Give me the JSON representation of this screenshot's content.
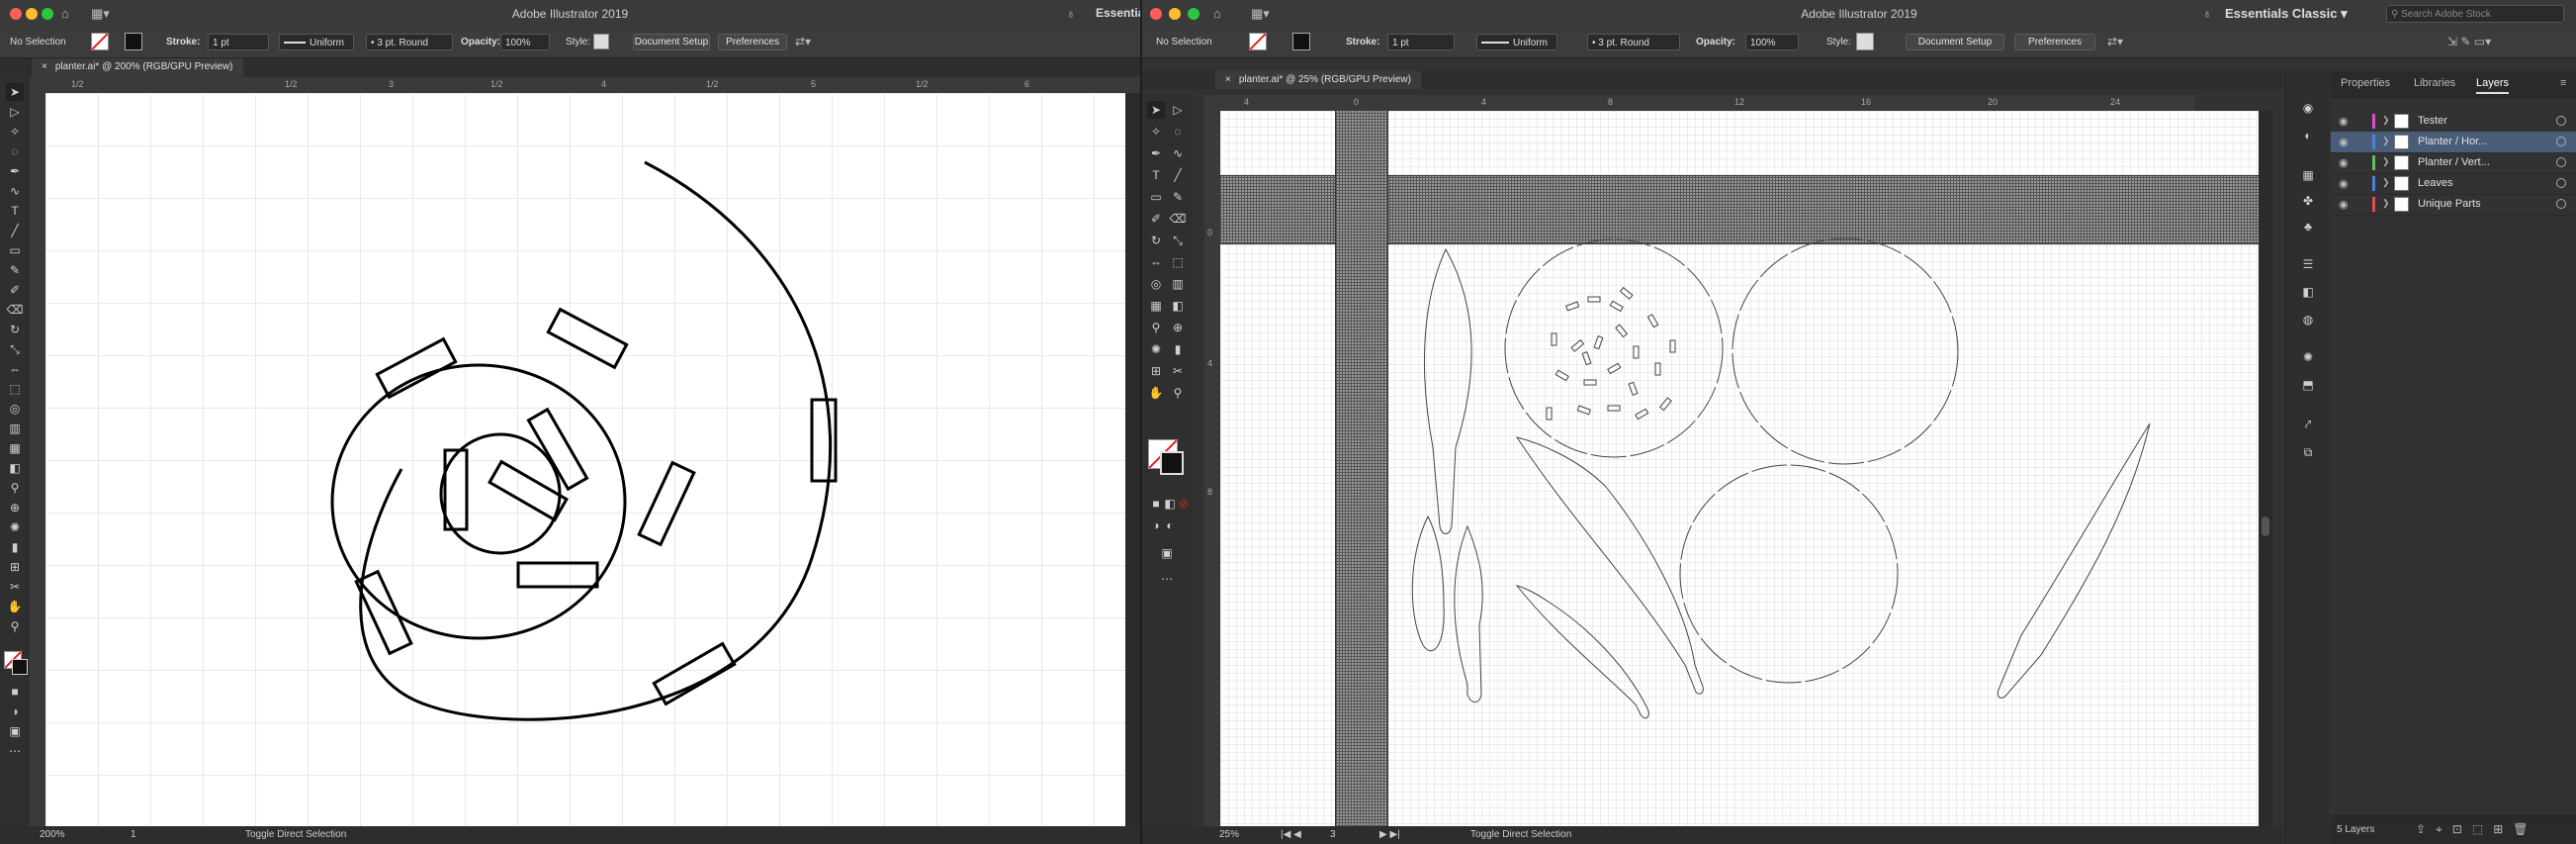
{
  "left_window": {
    "title": "Adobe Illustrator 2019",
    "workspace": "Essentials",
    "control": {
      "selection": "No Selection",
      "stroke_label": "Stroke:",
      "stroke_value": "1 pt",
      "profile": "Uniform",
      "brush": "3 pt. Round",
      "opacity_label": "Opacity:",
      "opacity_value": "100%",
      "style_label": "Style:",
      "doc_setup": "Document Setup",
      "preferences": "Preferences"
    },
    "tab": "planter.ai* @ 200% (RGB/GPU Preview)",
    "ruler_marks": [
      "1/2",
      "1/2",
      "3",
      "1/2",
      "4",
      "1/2",
      "5",
      "1/2",
      "6"
    ],
    "status": {
      "zoom": "200%",
      "page": "1",
      "info": "Toggle Direct Selection"
    }
  },
  "right_window": {
    "title": "Adobe Illustrator 2019",
    "workspace": "Essentials Classic",
    "search_placeholder": "Search Adobe Stock",
    "control": {
      "selection": "No Selection",
      "stroke_label": "Stroke:",
      "stroke_value": "1 pt",
      "profile": "Uniform",
      "brush": "3 pt. Round",
      "opacity_label": "Opacity:",
      "opacity_value": "100%",
      "style_label": "Style:",
      "doc_setup": "Document Setup",
      "preferences": "Preferences"
    },
    "tab": "planter.ai* @ 25% (RGB/GPU Preview)",
    "ruler_marks": [
      "4",
      "0",
      "4",
      "8",
      "12",
      "16",
      "20",
      "24"
    ],
    "vruler_marks": [
      "0",
      "4",
      "8"
    ],
    "status": {
      "zoom": "25%",
      "page": "3",
      "info": "Toggle Direct Selection"
    },
    "panel": {
      "tabs": [
        "Properties",
        "Libraries",
        "Layers"
      ],
      "layers": [
        {
          "name": "Tester",
          "color": "#d94fd6"
        },
        {
          "name": "Planter / Hor...",
          "color": "#4f7fe0"
        },
        {
          "name": "Planter / Vert...",
          "color": "#5fc06a"
        },
        {
          "name": "Leaves",
          "color": "#4f7fe0"
        },
        {
          "name": "Unique Parts",
          "color": "#e05050"
        }
      ],
      "layer_count": "5 Layers"
    }
  }
}
